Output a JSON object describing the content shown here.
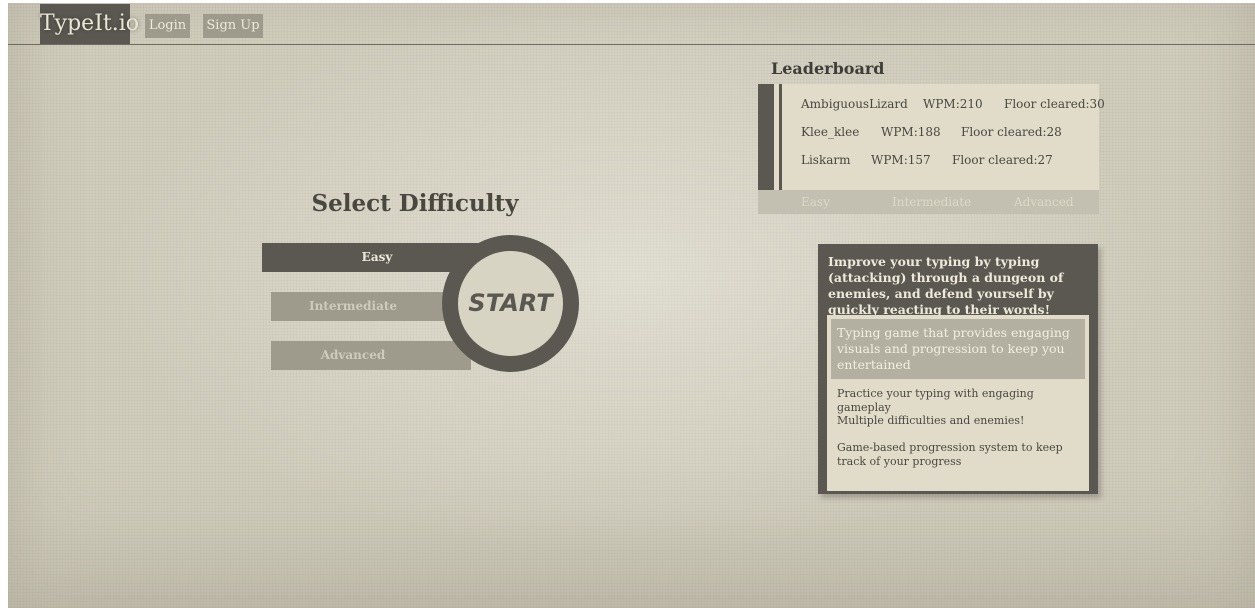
{
  "navbar": {
    "brand": "TypeIt.io",
    "login_label": "Login",
    "signup_label": "Sign Up"
  },
  "difficulty": {
    "title": "Select Difficulty",
    "options": [
      {
        "label": "Easy",
        "selected": true
      },
      {
        "label": "Intermediate",
        "selected": false
      },
      {
        "label": "Advanced",
        "selected": false
      }
    ],
    "start_label": "START"
  },
  "leaderboard": {
    "title": "Leaderboard",
    "rows": [
      {
        "name": "AmbiguousLizard",
        "wpm": "WPM:210",
        "floor": "Floor cleared:30"
      },
      {
        "name": "Klee_klee",
        "wpm": "WPM:188",
        "floor": "Floor cleared:28"
      },
      {
        "name": "Liskarm",
        "wpm": "WPM:157",
        "floor": "Floor cleared:27"
      }
    ],
    "tabs": [
      "Easy",
      "Intermediate",
      "Advanced"
    ]
  },
  "info": {
    "headline": "Improve your typing by typing (attacking) through a dungeon of enemies, and defend yourself by quickly reacting to their words!",
    "features": [
      "Typing game that provides engaging visuals and progression to keep you entertained",
      "Practice your typing with engaging gameplay",
      "Multiple difficulties and enemies!",
      "Game-based progression system to keep track of your progress"
    ]
  },
  "colors": {
    "background": "#d1cdbd",
    "dark": "#5b5851",
    "muted": "#9e9a8c",
    "panel": "#e0dcc9"
  }
}
